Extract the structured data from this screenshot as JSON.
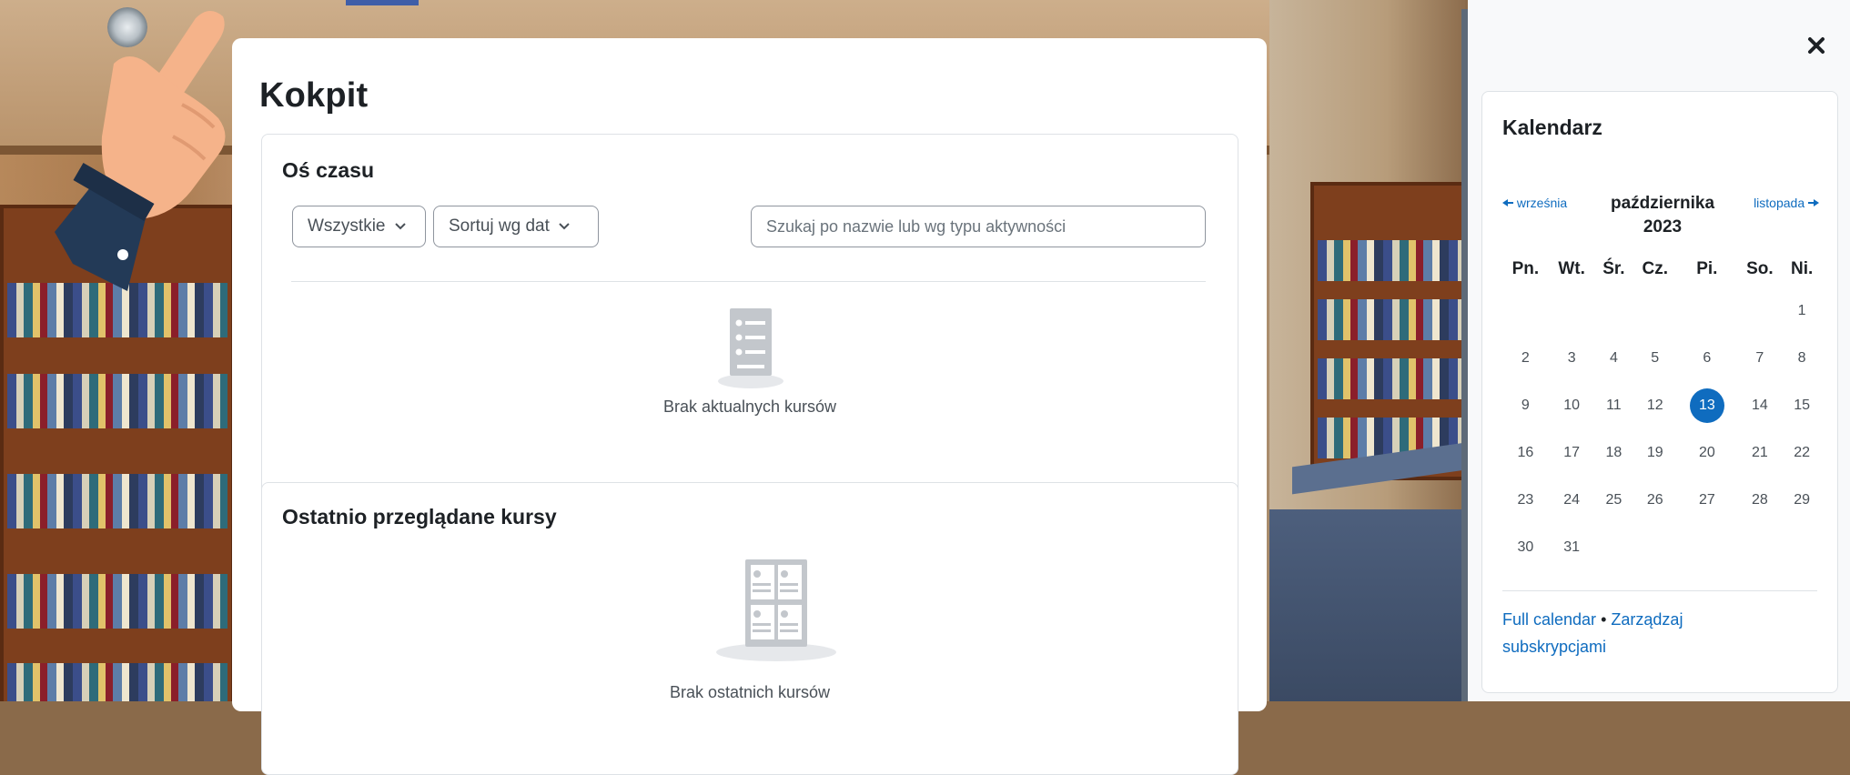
{
  "dashboard": {
    "title": "Kokpit"
  },
  "timeline": {
    "title": "Oś czasu",
    "filter_label": "Wszystkie",
    "sort_label": "Sortuj wg dat",
    "search_placeholder": "Szukaj po nazwie lub wg typu aktywności",
    "empty_text": "Brak aktualnych kursów"
  },
  "recent_courses": {
    "title": "Ostatnio przeglądane kursy",
    "empty_text": "Brak ostatnich kursów"
  },
  "calendar": {
    "title": "Kalendarz",
    "prev_month": "września",
    "current_month": "października",
    "current_year": "2023",
    "next_month": "listopada",
    "weekdays": [
      "Pn.",
      "Wt.",
      "Śr.",
      "Cz.",
      "Pi.",
      "So.",
      "Ni."
    ],
    "weeks": [
      [
        "",
        "",
        "",
        "",
        "",
        "",
        "1"
      ],
      [
        "2",
        "3",
        "4",
        "5",
        "6",
        "7",
        "8"
      ],
      [
        "9",
        "10",
        "11",
        "12",
        "13",
        "14",
        "15"
      ],
      [
        "16",
        "17",
        "18",
        "19",
        "20",
        "21",
        "22"
      ],
      [
        "23",
        "24",
        "25",
        "26",
        "27",
        "28",
        "29"
      ],
      [
        "30",
        "31",
        "",
        "",
        "",
        "",
        ""
      ]
    ],
    "today": "13",
    "full_calendar_link": "Full calendar",
    "separator": "•",
    "manage_subscriptions_link": "Zarządzaj subskrypcjami"
  },
  "colors": {
    "accent": "#0f6cbf",
    "text": "#1d2125",
    "muted": "#495057"
  },
  "icons": {
    "close": "close-icon",
    "prev": "arrow-left-icon",
    "next": "arrow-right-icon",
    "timeline_empty": "list-icon",
    "courses_empty": "courses-icon",
    "pointer": "pointing-hand-icon"
  }
}
